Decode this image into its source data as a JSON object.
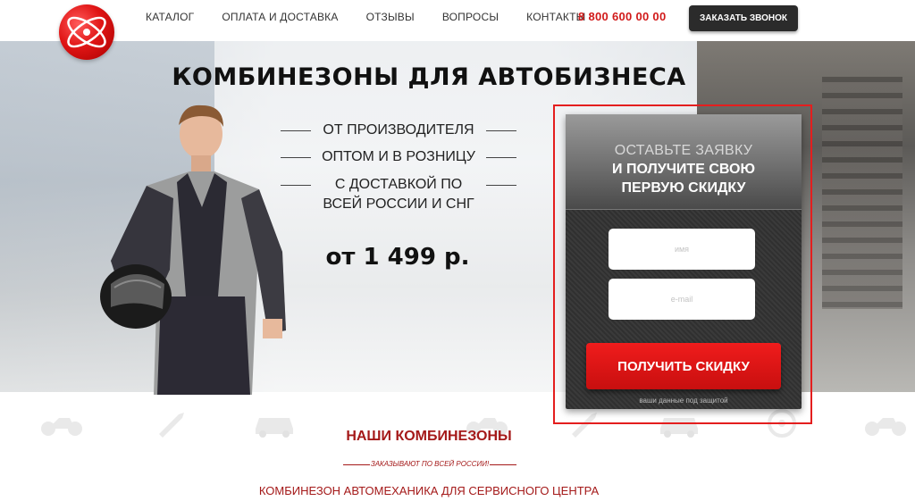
{
  "header": {
    "nav": [
      "КАТАЛОГ",
      "ОПЛАТА И ДОСТАВКА",
      "ОТЗЫВЫ",
      "ВОПРОСЫ",
      "КОНТАКТЫ"
    ],
    "phone": "8 800 600 00 00",
    "call_button": "ЗАКАЗАТЬ ЗВОНОК"
  },
  "hero": {
    "title": "КОМБИНЕЗОНЫ ДЛЯ АВТОБИЗНЕСА",
    "features": [
      "ОТ ПРОИЗВОДИТЕЛЯ",
      "ОПТОМ И В РОЗНИЦУ",
      "С ДОСТАВКОЙ ПО",
      "ВСЕЙ РОССИИ И СНГ"
    ],
    "price": "от 1 499 р."
  },
  "form": {
    "head_line1": "ОСТАВЬТЕ ЗАЯВКУ",
    "head_line2": "И ПОЛУЧИТЕ СВОЮ",
    "head_line3": "ПЕРВУЮ СКИДКУ",
    "name_placeholder": "имя",
    "email_placeholder": "e-mail",
    "submit": "ПОЛУЧИТЬ СКИДКУ",
    "secure_note": "ваши данные под защитой"
  },
  "section": {
    "title": "НАШИ КОМБИНЕЗОНЫ",
    "subtitle": "ЗАКАЗЫВАЮТ ПО ВСЕЙ РОССИИ!",
    "product": "КОМБИНЕЗОН АВТОМЕХАНИКА ДЛЯ СЕРВИСНОГО ЦЕНТРА"
  },
  "colors": {
    "accent_red": "#d11a1a",
    "section_red": "#a41919",
    "form_bg": "#333333"
  },
  "icons": [
    "motorcycle-icon",
    "wrench-icon",
    "car-icon",
    "steering-wheel-icon"
  ]
}
